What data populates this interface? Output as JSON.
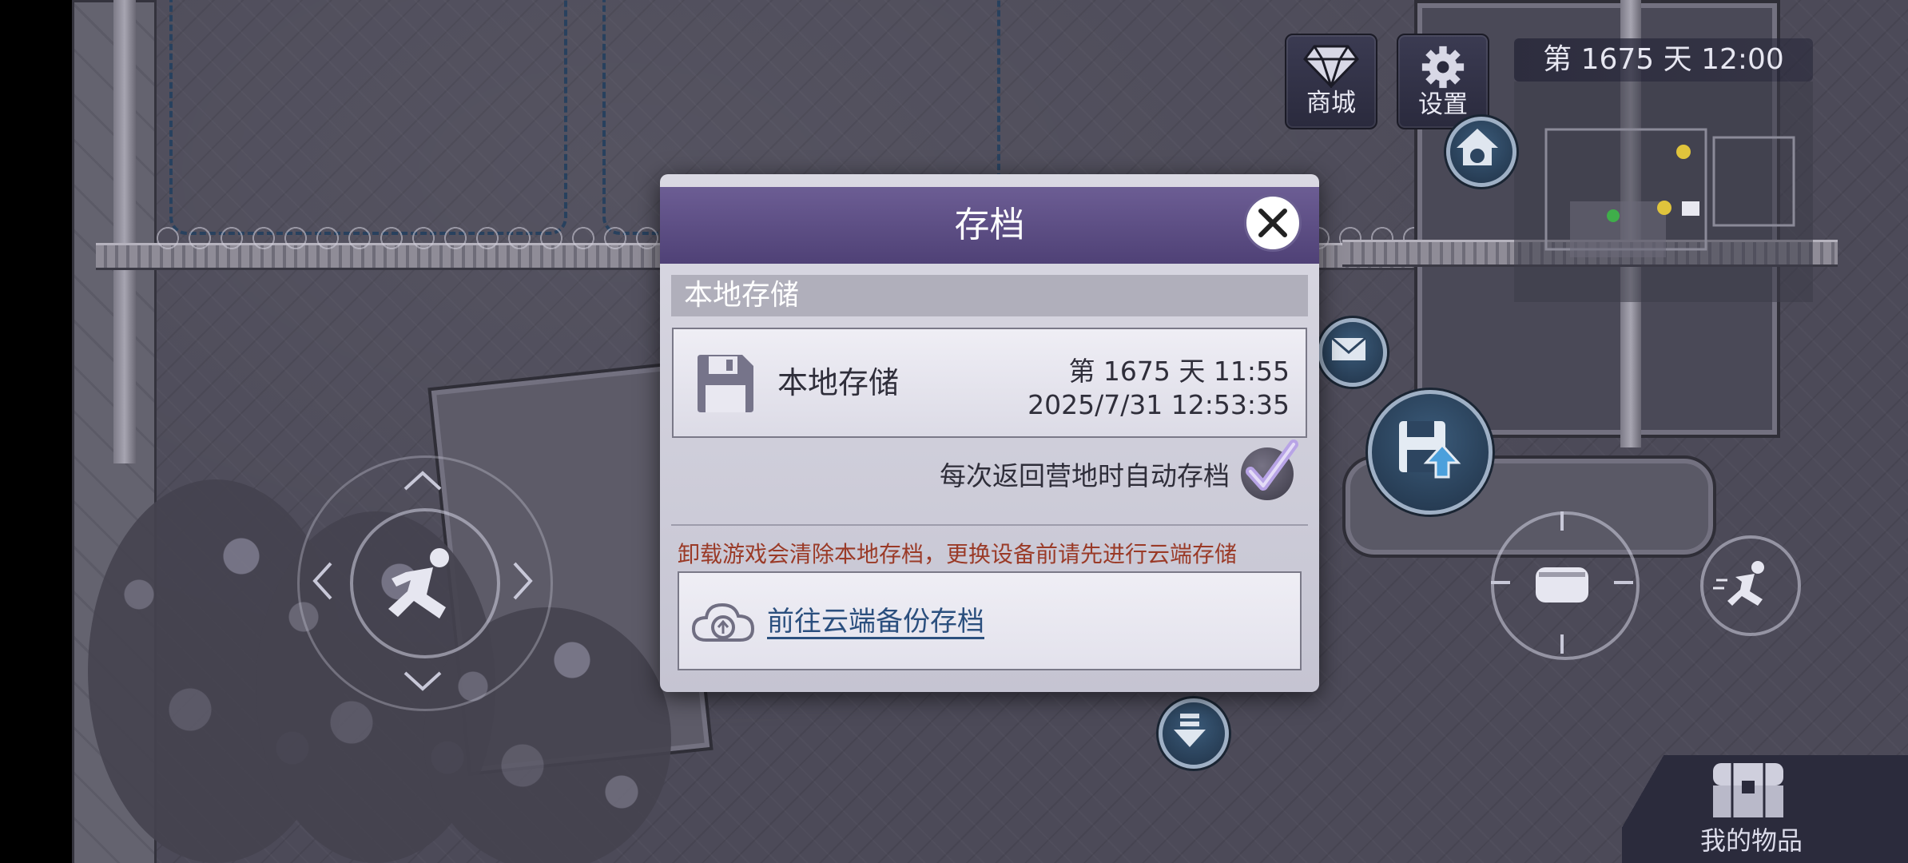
{
  "hud": {
    "shop_label": "商城",
    "settings_label": "设置",
    "day_clock": "第 1675 天   12:00",
    "inventory_label": "我的物品"
  },
  "dialog": {
    "title": "存档",
    "section_label": "本地存储",
    "slot": {
      "name": "本地存储",
      "day_time": "第 1675 天   11:55",
      "timestamp": "2025/7/31 12:53:35"
    },
    "auto_save_label": "每次返回营地时自动存档",
    "auto_save_checked": true,
    "warning": "卸载游戏会清除本地存档，更换设备前请先进行云端存储",
    "cloud_link": "前往云端备份存档"
  },
  "colors": {
    "header": "#5a4c83",
    "warning": "#9a3a27",
    "link": "#2b4f7e"
  },
  "icons": [
    "diamond-icon",
    "gear-icon",
    "close-icon",
    "floppy-disk-icon",
    "checkmark-icon",
    "cloud-upload-icon",
    "save-upload-icon",
    "running-man-icon",
    "fist-icon",
    "chest-icon",
    "mail-icon",
    "dog-house-icon",
    "arrow-down-icon"
  ]
}
